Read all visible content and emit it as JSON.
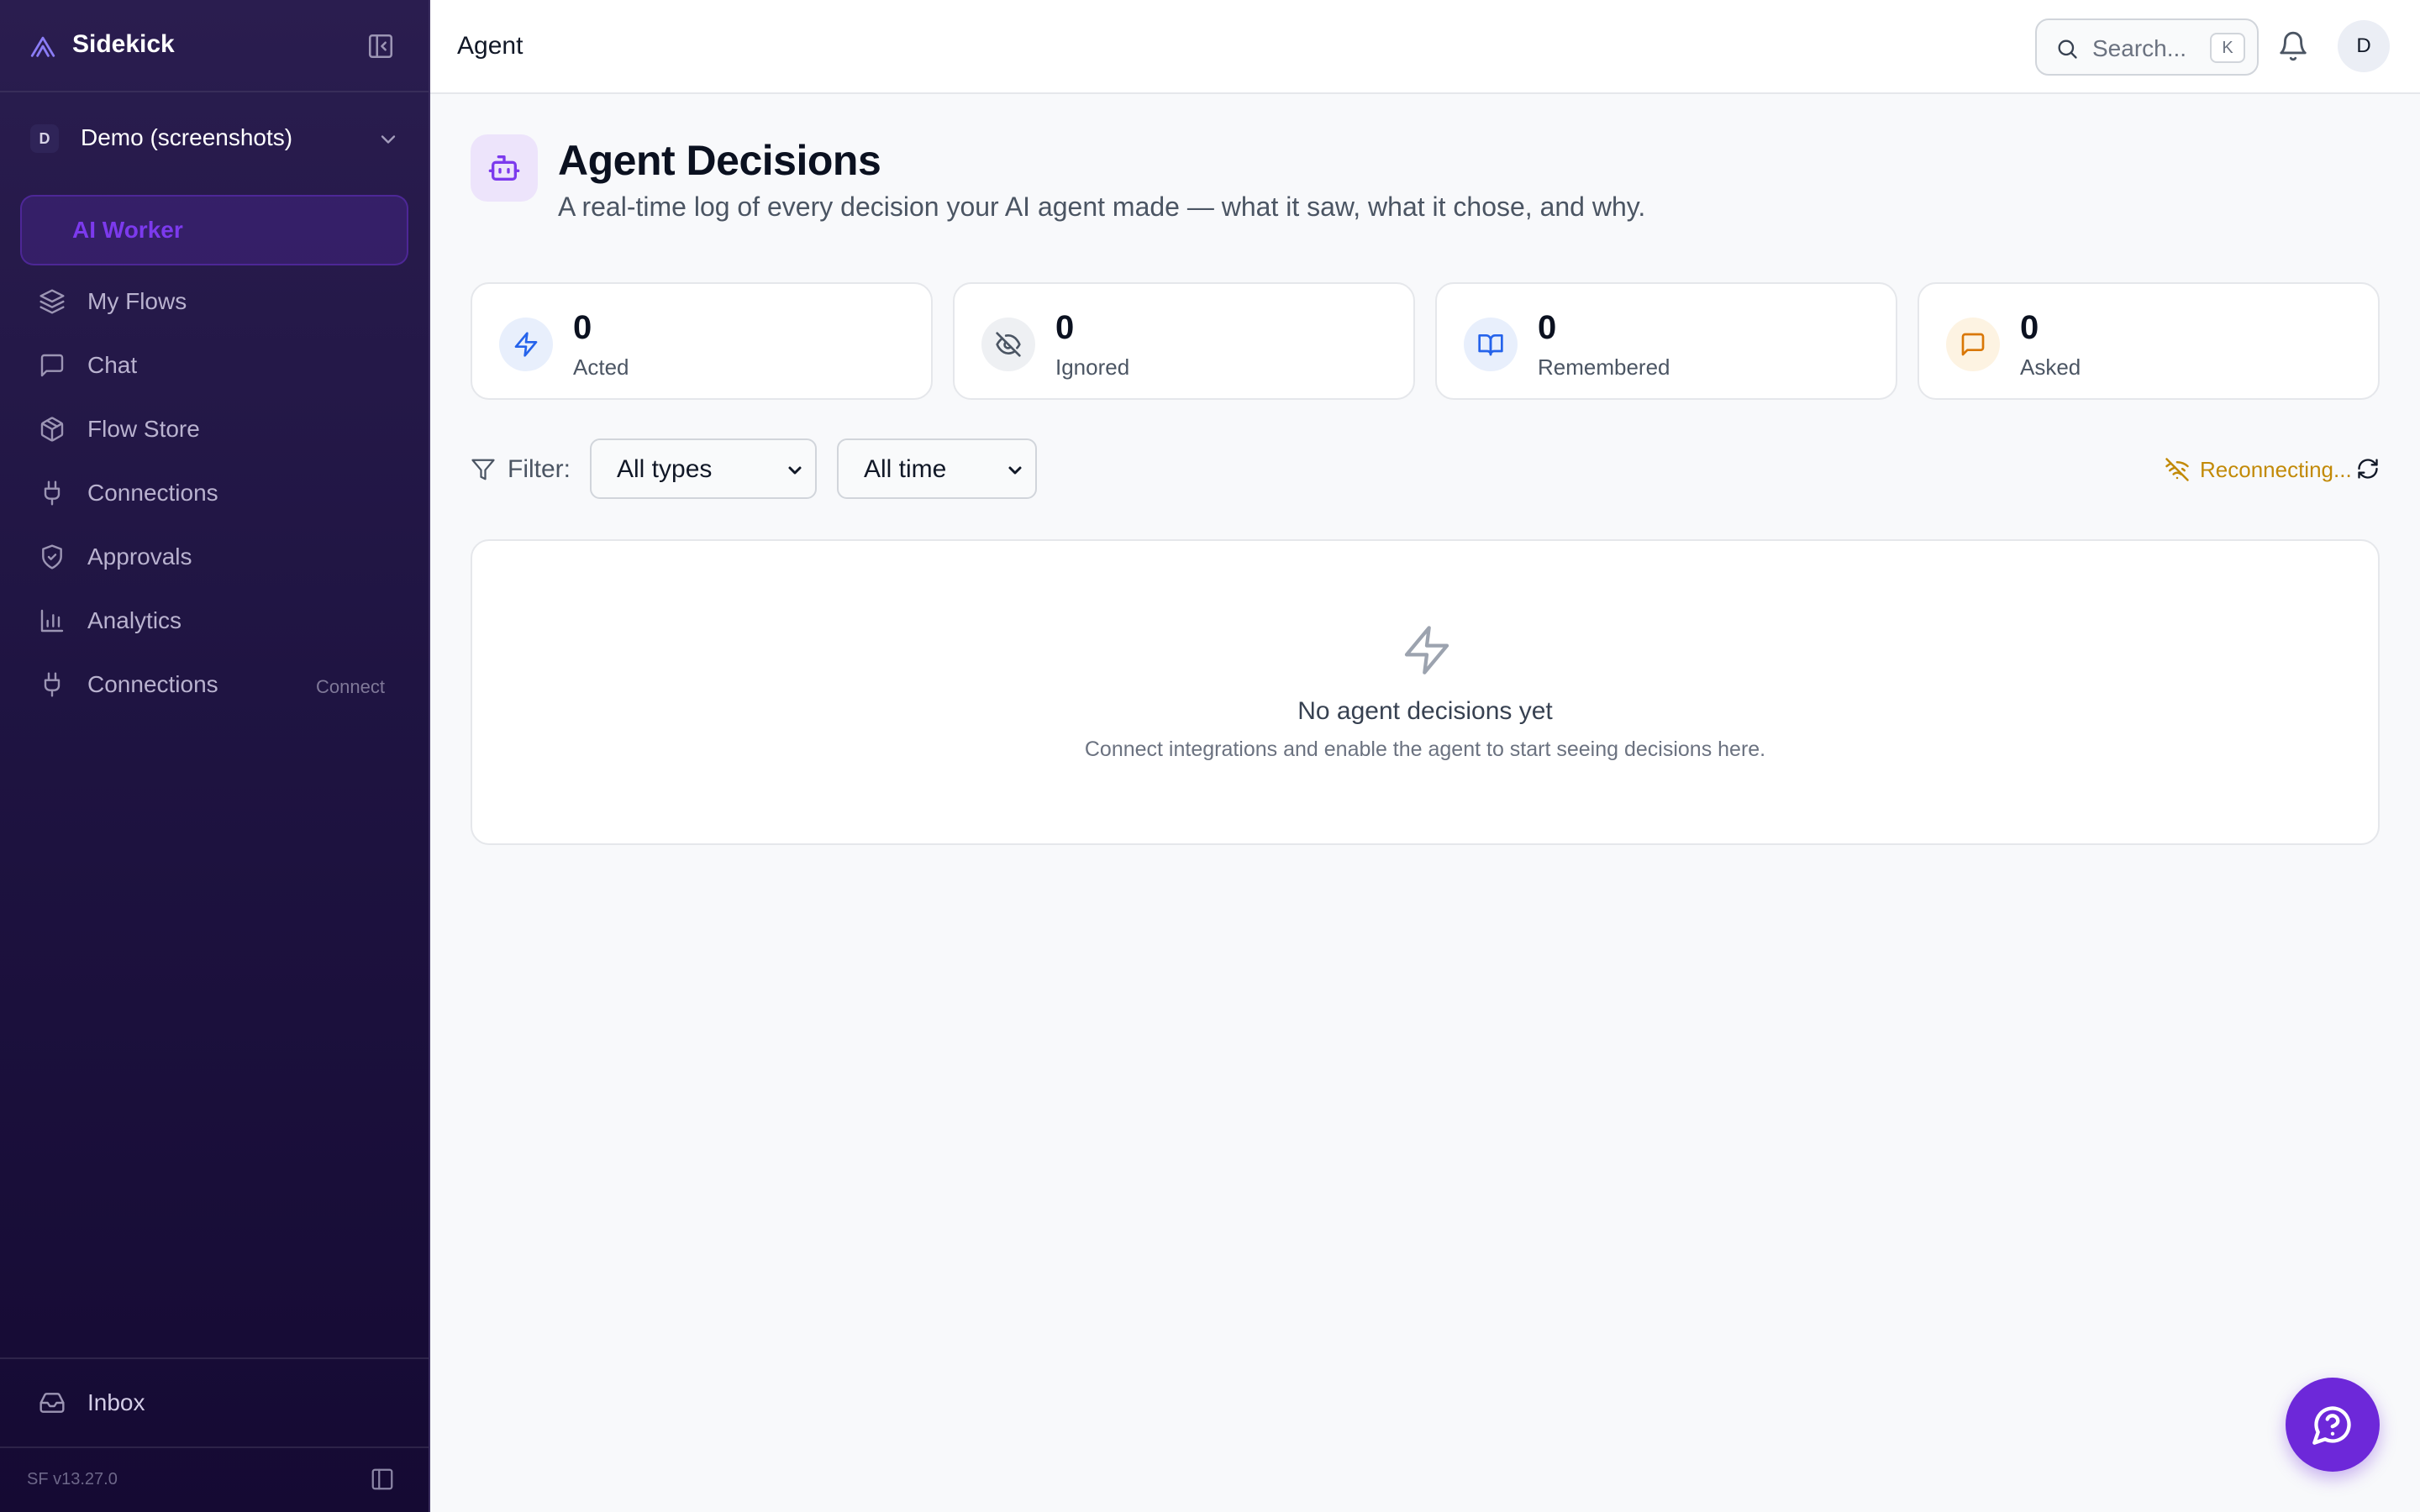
{
  "app": {
    "name": "Sidekick",
    "version": "SF v13.27.0"
  },
  "workspace": {
    "initial": "D",
    "name": "Demo (screenshots)"
  },
  "sidebar": {
    "active_label": "AI Worker",
    "items": [
      {
        "label": "My Flows",
        "icon": "layers-icon"
      },
      {
        "label": "Chat",
        "icon": "chat-icon"
      },
      {
        "label": "Flow Store",
        "icon": "package-icon"
      },
      {
        "label": "Connections",
        "icon": "plug-icon"
      },
      {
        "label": "Approvals",
        "icon": "shield-check-icon"
      },
      {
        "label": "Analytics",
        "icon": "bar-chart-icon"
      },
      {
        "label": "Connections",
        "icon": "plug-icon",
        "badge": "Connect"
      }
    ],
    "bottom_item": {
      "label": "Inbox",
      "icon": "inbox-icon"
    }
  },
  "topbar": {
    "title": "Agent",
    "search_placeholder": "Search...",
    "search_shortcut": "K",
    "user_initial": "D"
  },
  "page": {
    "title": "Agent Decisions",
    "subtitle": "A real-time log of every decision your AI agent made — what it saw, what it chose, and why."
  },
  "stats": [
    {
      "value": "0",
      "label": "Acted",
      "icon": "zap-icon",
      "color": "#2563eb",
      "bg": "#e8effc"
    },
    {
      "value": "0",
      "label": "Ignored",
      "icon": "eye-off-icon",
      "color": "#4b5563",
      "bg": "#eef0f3"
    },
    {
      "value": "0",
      "label": "Remembered",
      "icon": "book-open-icon",
      "color": "#2563eb",
      "bg": "#e8effc"
    },
    {
      "value": "0",
      "label": "Asked",
      "icon": "message-square-icon",
      "color": "#d97706",
      "bg": "#fdf3e2"
    }
  ],
  "filter": {
    "label": "Filter:",
    "type_value": "All types",
    "time_value": "All time"
  },
  "status": {
    "text": "Reconnecting...",
    "color": "#c28a08"
  },
  "empty": {
    "title": "No agent decisions yet",
    "description": "Connect integrations and enable the agent to start seeing decisions here."
  },
  "colors": {
    "accent": "#7c3aed",
    "fab": "#6d28d9",
    "sidebar_bg": "#1f1442"
  }
}
